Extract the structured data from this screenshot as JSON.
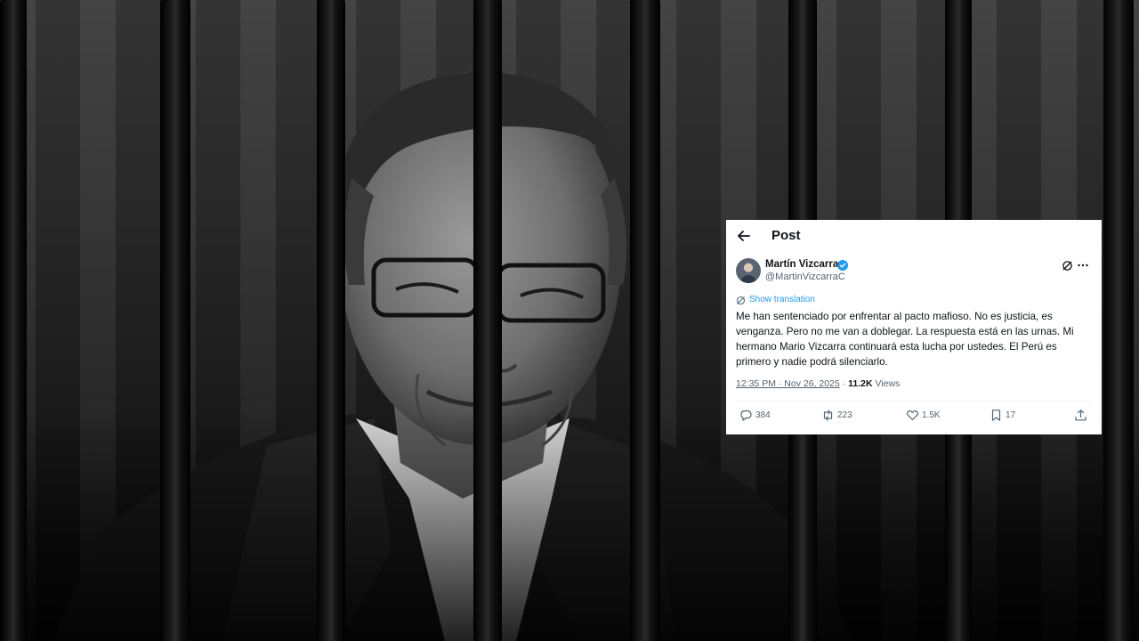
{
  "header": {
    "title": "Post",
    "back_icon": "arrow-left-icon"
  },
  "author": {
    "name": "Martín Vizcarra",
    "handle": "@MartinVizcarraC",
    "verified_color": "#1d9bf0"
  },
  "translation": {
    "label": "Show translation",
    "icon": "translate-icon"
  },
  "tweet": {
    "text": "Me han sentenciado por enfrentar al pacto mafioso. No es justicia, es venganza. Pero no me van a doblegar. La respuesta está en las urnas. Mi hermano Mario Vizcarra continuará esta lucha por ustedes. El Perú es primero y nadie podrá silenciarlo."
  },
  "meta": {
    "timestamp": "12:35 PM · Nov 26, 2025",
    "separator": "·",
    "views_count": "11.2K",
    "views_label": "Views"
  },
  "actions": {
    "replies": "384",
    "reposts": "223",
    "likes": "1.5K",
    "bookmarks": "17"
  },
  "colors": {
    "accent": "#1d9bf0",
    "text": "#0f1419",
    "secondary": "#536471"
  }
}
